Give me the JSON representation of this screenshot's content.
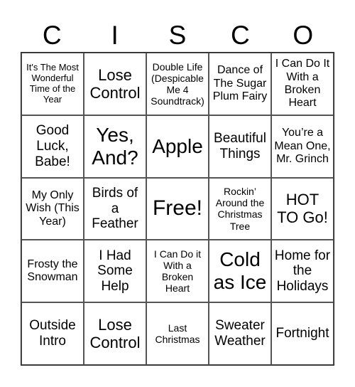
{
  "card": {
    "header": [
      "C",
      "I",
      "S",
      "C",
      "O"
    ],
    "rows": [
      [
        "It's The Most Wonderful Time of the Year",
        "Lose Control",
        "Double Life (Despicable Me 4 Soundtrack)",
        "Dance of The Sugar Plum Fairy",
        "I Can Do It With a Broken Heart"
      ],
      [
        "Good Luck, Babe!",
        "Yes, And?",
        "Apple",
        "Beautiful Things",
        "You’re a Mean One, Mr. Grinch"
      ],
      [
        "My Only Wish (This Year)",
        "Birds of a Feather",
        "Free!",
        "Rockin’ Around the Christmas Tree",
        "HOT TO Go!"
      ],
      [
        "Frosty the Snowman",
        "I Had Some Help",
        "I Can Do it With a Broken Heart",
        "Cold as Ice",
        "Home for the Holidays"
      ],
      [
        "Outside Intro",
        "Lose Control",
        "Last Christmas",
        "Sweater Weather",
        "Fortnight"
      ]
    ]
  }
}
